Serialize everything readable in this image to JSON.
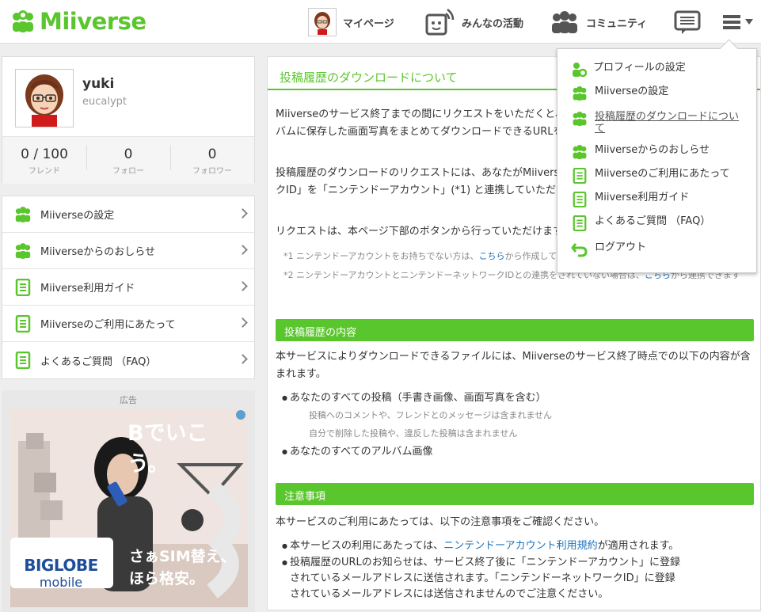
{
  "header": {
    "logo_text": "Miiverse",
    "nav": {
      "mypage": "マイページ",
      "activity": "みんなの活動",
      "community": "コミュニティ"
    }
  },
  "profile": {
    "username": "yuki",
    "user_id": "eucalypt",
    "stats": [
      {
        "value": "0 / 100",
        "label": "フレンド"
      },
      {
        "value": "0",
        "label": "フォロー"
      },
      {
        "value": "0",
        "label": "フォロワー"
      }
    ]
  },
  "side_menu": [
    {
      "label": "Miiverseの設定",
      "icon": "mii-group-icon"
    },
    {
      "label": "Miiverseからのおしらせ",
      "icon": "mii-group-icon"
    },
    {
      "label": "Miiverse利用ガイド",
      "icon": "document-icon"
    },
    {
      "label": "Miiverseのご利用にあたって",
      "icon": "document-icon"
    },
    {
      "label": "よくあるご質問 （FAQ）",
      "icon": "document-icon"
    }
  ],
  "ad": {
    "label": "広告",
    "headline": "Bでいこう。",
    "tagline1": "さぁSIM替え、",
    "tagline2": "ほら格安。",
    "brand1": "BIGLOBE",
    "brand2": "mobile"
  },
  "main": {
    "title": "投稿履歴のダウンロードについて",
    "para1": "Miiverseのサービス終了までの間にリクエストをいただくと、サービス終了後に、あなたの投稿やアルバムに保存した画面写真をまとめてダウンロードできるURLをメールでお送りします。",
    "para2": "投稿履歴のダウンロードのリクエストには、あなたがMiiverseを利用しているニンテンドーネットワークID」を「ニンテンドーアカウント」(*1) と連携していただく必要があります。",
    "para3": "リクエストは、本ページ下部のボタンから行っていただけます。",
    "note1_pre": "*1 ニンテンドーアカウントをお持ちでない方は、",
    "note1_link": "こちら",
    "note1_post": "から作成してください。",
    "note2_pre": "*2 ニンテンドーアカウントとニンテンドーネットワークIDとの連携をされていない場合は、",
    "note2_link": "こちら",
    "note2_post": "から連携できます",
    "section1": "投稿履歴の内容",
    "section1_text": "本サービスによりダウンロードできるファイルには、Miiverseのサービス終了時点での以下の内容が含まれます。",
    "item1": "あなたのすべての投稿（手書き画像、画面写真を含む）",
    "item1_sub1": "投稿へのコメントや、フレンドとのメッセージは含まれません",
    "item1_sub2": "自分で削除した投稿や、違反した投稿は含まれません",
    "item2": "あなたのすべてのアルバム画像",
    "section2": "注意事項",
    "section2_text": "本サービスのご利用にあたっては、以下の注意事項をご確認ください。",
    "caution1_pre": "本サービスの利用にあたっては、",
    "caution1_link": "ニンテンドーアカウント利用規約",
    "caution1_post": "が適用されます。",
    "caution2_l1": "投稿履歴のURLのお知らせは、サービス終了後に「ニンテンドーアカウント」に登録",
    "caution2_l2": "されているメールアドレスに送信されます。「ニンテンドーネットワークID」に登録",
    "caution2_l3": "されているメールアドレスには送信されませんのでご注意ください。"
  },
  "dropdown": [
    {
      "label": "プロフィールの設定",
      "icon": "profile-settings-icon"
    },
    {
      "label": "Miiverseの設定",
      "icon": "mii-group-icon"
    },
    {
      "label": "投稿履歴のダウンロードについて",
      "icon": "mii-group-icon",
      "active": true
    },
    {
      "label": "Miiverseからのおしらせ",
      "icon": "mii-group-icon"
    },
    {
      "label": "Miiverseのご利用にあたって",
      "icon": "document-icon"
    },
    {
      "label": "Miiverse利用ガイド",
      "icon": "document-icon"
    },
    {
      "label": "よくあるご質問 （FAQ）",
      "icon": "document-icon"
    },
    {
      "label": "ログアウト",
      "icon": "logout-icon"
    }
  ],
  "colors": {
    "brand_green": "#5ac62d",
    "link_blue": "#1e73be"
  }
}
